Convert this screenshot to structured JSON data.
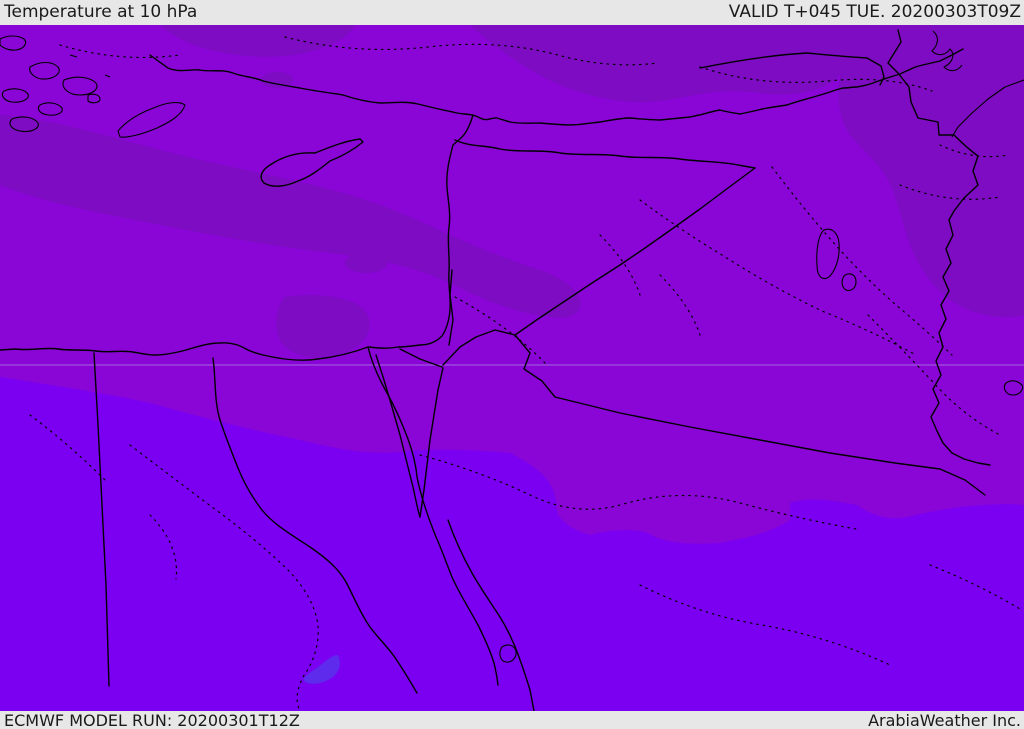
{
  "header": {
    "title": "Temperature at 10 hPa",
    "valid_label": "VALID T+045 TUE. 20200303T09Z"
  },
  "footer": {
    "model_run_label": "ECMWF MODEL RUN: 20200301T12Z",
    "credit_label": "ArabiaWeather Inc."
  },
  "map": {
    "type": "weather-temperature-map",
    "field": "Temperature at 10 hPa",
    "region": "Eastern Mediterranean / Middle East (Turkey, Cyprus, Levant, Egypt, Iraq, northern Saudi Arabia)",
    "colors": {
      "bar_background": "#E7E7E7",
      "bar_text": "#1A1A1A",
      "field_base_purple": "#8906D6",
      "field_dark_purple": "#7D0CC2",
      "field_bright_violet": "#7B00F2",
      "field_blue_spot": "#5E2AEC",
      "map_lines": "#000000",
      "graticule": "#AD7FE0"
    }
  }
}
